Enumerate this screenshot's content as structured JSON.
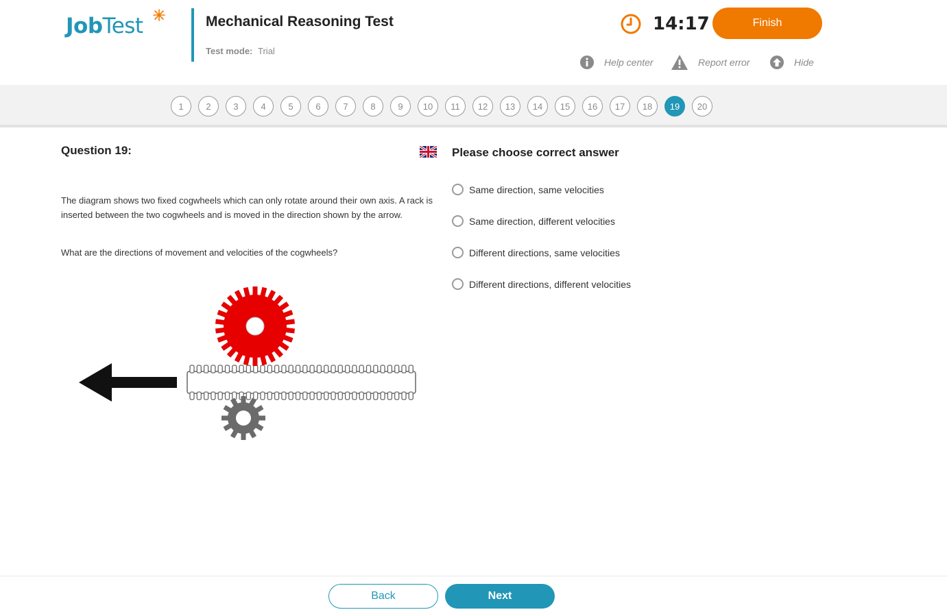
{
  "header": {
    "logo_primary": "Job",
    "logo_secondary": "Test",
    "title": "Mechanical Reasoning Test",
    "mode_label": "Test mode:",
    "mode_value": "Trial",
    "timer": "14:17",
    "finish_label": "Finish",
    "accent_color": "#2196b7",
    "finish_color": "#f07900"
  },
  "tools": {
    "help_label": "Help center",
    "report_label": "Report error",
    "hide_label": "Hide"
  },
  "navigation": {
    "questions": [
      "1",
      "2",
      "3",
      "4",
      "5",
      "6",
      "7",
      "8",
      "9",
      "10",
      "11",
      "12",
      "13",
      "14",
      "15",
      "16",
      "17",
      "18",
      "19",
      "20"
    ],
    "current": "19"
  },
  "question": {
    "title": "Question 19:",
    "language_icon": "uk-flag-icon",
    "text": "The diagram shows two fixed cogwheels which can only rotate around their own axis. A rack is inserted between the two cogwheels and is moved in the direction shown by the arrow.",
    "sub_text": "What are the directions of movement and velocities of the cogwheels?"
  },
  "answers": {
    "title": "Please choose correct answer",
    "options": [
      "Same direction, same velocities",
      "Same direction, different velocities",
      "Different directions, same velocities",
      "Different directions, different velocities"
    ]
  },
  "footer": {
    "back_label": "Back",
    "next_label": "Next"
  }
}
